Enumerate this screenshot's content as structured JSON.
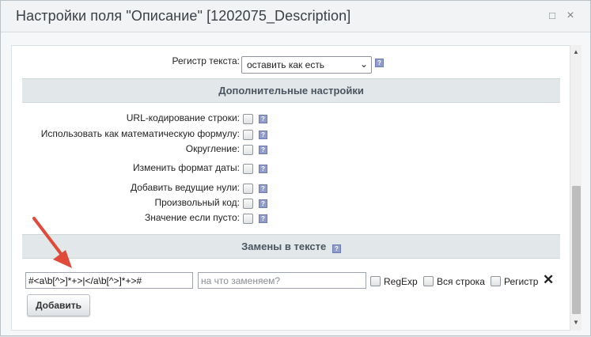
{
  "dialog": {
    "title": "Настройки поля \"Описание\" [1202075_Description]",
    "buttons": {
      "maximize": "□",
      "close": "×"
    }
  },
  "case_row": {
    "label": "Регистр текста:",
    "select_value": "оставить как есть",
    "help": "?"
  },
  "sections": {
    "additional": "Дополнительные настройки",
    "replacements": "Замены в тексте"
  },
  "options": [
    {
      "label": "URL-кодирование строки:",
      "help": "?"
    },
    {
      "label": "Использовать как математическую формулу:",
      "help": "?"
    },
    {
      "label": "Округление:",
      "help": "?"
    },
    {
      "label": "Изменить формат даты:",
      "help": "?"
    },
    {
      "label": "Добавить ведущие нули:",
      "help": "?"
    },
    {
      "label": "Произвольный код:",
      "help": "?"
    },
    {
      "label": "Значение если пусто:",
      "help": "?"
    }
  ],
  "replace": {
    "help": "?",
    "search_value": "#<a\\b[^>]*+>|</a\\b[^>]*+>#",
    "replace_placeholder": "на что заменяем?",
    "regexp_label": "RegExp",
    "whole_label": "Вся строка",
    "case_label": "Регистр",
    "remove": "✕",
    "add_button": "Добавить"
  },
  "colors": {
    "annotation_arrow": "#e04a3a",
    "help_icon": "#8f9ccc",
    "section_bg": "#e2e8e9"
  }
}
